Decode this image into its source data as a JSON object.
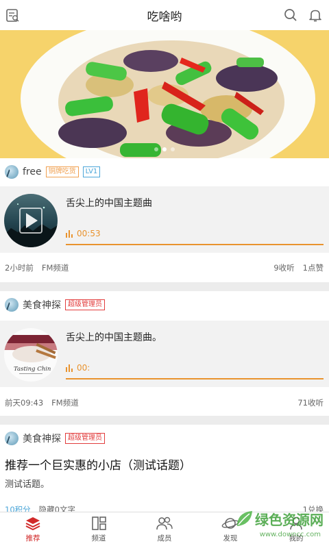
{
  "header": {
    "title": "吃啥哟"
  },
  "posts": [
    {
      "user": "free",
      "badges": [
        "铜牌吃货",
        "LV1"
      ],
      "audio_title": "舌尖上的中国主题曲",
      "duration": "00:53",
      "time": "2小时前",
      "channel": "FM频道",
      "listens": "9收听",
      "likes": "1点赞"
    },
    {
      "user": "美食神探",
      "badges": [
        "超级管理员"
      ],
      "audio_title": "舌尖上的中国主题曲。",
      "duration": "00:",
      "cover_text": "Tasting Chin",
      "time": "前天09:43",
      "channel": "FM频道",
      "listens": "71收听"
    },
    {
      "user": "美食神探",
      "badges": [
        "超级管理员"
      ],
      "title": "推荐一个巨实惠的小店（测试话题）",
      "body": "测试话题。",
      "footer_left": "10积分",
      "footer_mid": "隐藏0文字",
      "footer_right": "1兑换"
    }
  ],
  "nav": [
    {
      "label": "推荐",
      "icon": "stack-icon",
      "active": true
    },
    {
      "label": "频道",
      "icon": "channel-grid-icon",
      "active": false
    },
    {
      "label": "成员",
      "icon": "members-icon",
      "active": false
    },
    {
      "label": "发现",
      "icon": "planet-icon",
      "active": false
    },
    {
      "label": "我的",
      "icon": "profile-icon",
      "active": false
    }
  ],
  "watermark": {
    "text": "绿色资源网",
    "url": "www.downcc.com"
  },
  "colors": {
    "accent_orange": "#e9932e",
    "nav_active_red": "#d12a2a",
    "badge_red": "#e23c3c",
    "badge_blue": "#4aa5d8",
    "badge_orange": "#f0a050"
  }
}
